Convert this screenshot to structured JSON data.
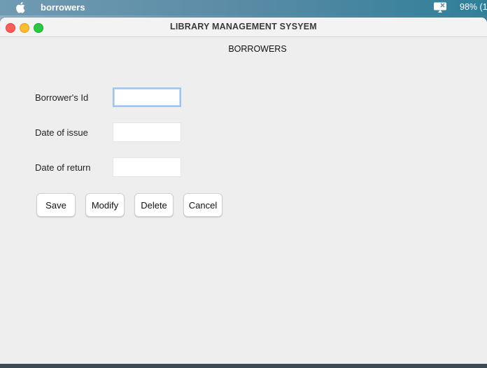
{
  "menubar": {
    "app_name": "borrowers",
    "battery": "98% (1"
  },
  "window": {
    "title": "LIBRARY MANAGEMENT SYSYEM",
    "heading": "BORROWERS"
  },
  "form": {
    "borrower_id": {
      "label": "Borrower's Id",
      "value": ""
    },
    "date_of_issue": {
      "label": "Date of issue",
      "value": ""
    },
    "date_of_return": {
      "label": "Date of return",
      "value": ""
    }
  },
  "buttons": {
    "save": "Save",
    "modify": "Modify",
    "delete": "Delete",
    "cancel": "Cancel"
  },
  "colors": {
    "close": "#ff5f57",
    "minimize": "#febc2e",
    "maximize": "#28c840",
    "focus_ring": "#9ec3ee"
  }
}
